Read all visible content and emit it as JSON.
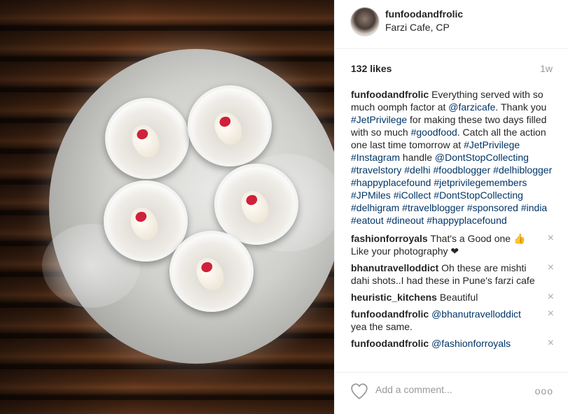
{
  "header": {
    "username": "funfoodandfrolic",
    "location": "Farzi Cafe, CP"
  },
  "meta": {
    "likes": "132 likes",
    "time": "1w"
  },
  "caption": {
    "user": "funfoodandfrolic",
    "t1": " Everything served with so much oomph factor at ",
    "tag1": "@farzicafe",
    "t2": ". Thank you ",
    "tag2": "#JetPrivilege",
    "t3": " for making these two days filled with so much ",
    "tag3": "#goodfood",
    "t4": ". Catch all the action one last time tomorrow at ",
    "tag4": "#JetPrivilege",
    "t5": " ",
    "tag5": "#Instagram",
    "t6": " handle ",
    "tag6": "@DontStopCollecting",
    "t7": " ",
    "tag7": "#travelstory",
    "t8": " ",
    "tag8": "#delhi",
    "t9": " ",
    "tag9": "#foodblogger",
    "t10": " ",
    "tag10": "#delhiblogger",
    "t11": " ",
    "tag11": "#happyplacefound",
    "t12": " ",
    "tag12": "#jetprivilegemembers",
    "t13": " ",
    "tag13": "#JPMiles",
    "t14": " ",
    "tag14": "#iCollect",
    "t15": " ",
    "tag15": "#DontStopCollecting",
    "t16": " ",
    "tag16": "#delhigram",
    "t17": " ",
    "tag17": "#travelblogger",
    "t18": " ",
    "tag18": "#sponsored",
    "t19": " ",
    "tag19": "#india",
    "t20": " ",
    "tag20": "#eatout",
    "t21": " ",
    "tag21": "#dineout",
    "t22": " ",
    "tag22": "#happyplacefound"
  },
  "comments": [
    {
      "user": "fashionforroyals",
      "text": " That's a Good one 👍 Like your photography ❤"
    },
    {
      "user": "bhanutravelloddict",
      "text": " Oh these are mishti dahi shots..I had these in Pune's farzi cafe"
    },
    {
      "user": "heuristic_kitchens",
      "text": " Beautiful"
    },
    {
      "user": "funfoodandfrolic",
      "tag": "@bhanutravelloddict",
      "text": " yea the same."
    },
    {
      "user": "funfoodandfrolic",
      "tag": "@fashionforroyals",
      "text": ""
    }
  ],
  "footer": {
    "placeholder": "Add a comment...",
    "more": "ooo"
  },
  "icons": {
    "close": "×",
    "heart": "heart-icon"
  }
}
